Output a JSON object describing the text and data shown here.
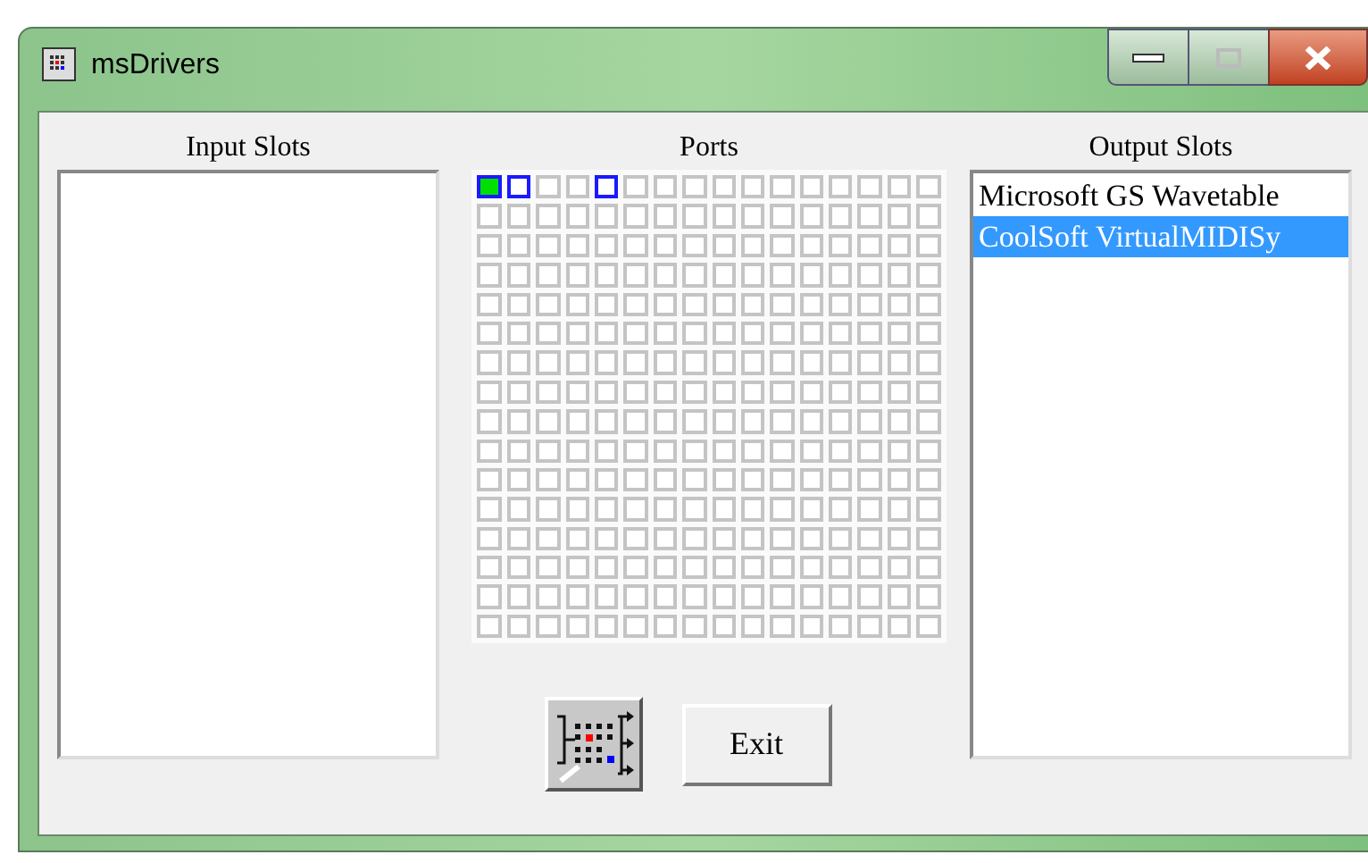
{
  "window": {
    "title": "msDrivers"
  },
  "input_slots": {
    "label": "Input Slots"
  },
  "ports": {
    "label": "Ports",
    "rows": [
      [
        {
          "kind": "on"
        },
        {
          "kind": "linked"
        },
        {
          "kind": "off"
        },
        {
          "kind": "off"
        },
        {
          "kind": "linked"
        },
        {
          "kind": "off"
        },
        {
          "kind": "off"
        },
        {
          "kind": "off"
        },
        {
          "kind": "off"
        },
        {
          "kind": "off"
        },
        {
          "kind": "off"
        },
        {
          "kind": "off"
        },
        {
          "kind": "off"
        },
        {
          "kind": "off"
        },
        {
          "kind": "off"
        },
        {
          "kind": "off"
        }
      ],
      [
        {
          "kind": "off"
        },
        {
          "kind": "off"
        },
        {
          "kind": "off"
        },
        {
          "kind": "off"
        },
        {
          "kind": "off"
        },
        {
          "kind": "off"
        },
        {
          "kind": "off"
        },
        {
          "kind": "off"
        },
        {
          "kind": "off"
        },
        {
          "kind": "off"
        },
        {
          "kind": "off"
        },
        {
          "kind": "off"
        },
        {
          "kind": "off"
        },
        {
          "kind": "off"
        },
        {
          "kind": "off"
        },
        {
          "kind": "off"
        }
      ],
      [
        {
          "kind": "off"
        },
        {
          "kind": "off"
        },
        {
          "kind": "off"
        },
        {
          "kind": "off"
        },
        {
          "kind": "off"
        },
        {
          "kind": "off"
        },
        {
          "kind": "off"
        },
        {
          "kind": "off"
        },
        {
          "kind": "off"
        },
        {
          "kind": "off"
        },
        {
          "kind": "off"
        },
        {
          "kind": "off"
        },
        {
          "kind": "off"
        },
        {
          "kind": "off"
        },
        {
          "kind": "off"
        },
        {
          "kind": "off"
        }
      ],
      [
        {
          "kind": "off"
        },
        {
          "kind": "off"
        },
        {
          "kind": "off"
        },
        {
          "kind": "off"
        },
        {
          "kind": "off"
        },
        {
          "kind": "off"
        },
        {
          "kind": "off"
        },
        {
          "kind": "off"
        },
        {
          "kind": "off"
        },
        {
          "kind": "off"
        },
        {
          "kind": "off"
        },
        {
          "kind": "off"
        },
        {
          "kind": "off"
        },
        {
          "kind": "off"
        },
        {
          "kind": "off"
        },
        {
          "kind": "off"
        }
      ],
      [
        {
          "kind": "off"
        },
        {
          "kind": "off"
        },
        {
          "kind": "off"
        },
        {
          "kind": "off"
        },
        {
          "kind": "off"
        },
        {
          "kind": "off"
        },
        {
          "kind": "off"
        },
        {
          "kind": "off"
        },
        {
          "kind": "off"
        },
        {
          "kind": "off"
        },
        {
          "kind": "off"
        },
        {
          "kind": "off"
        },
        {
          "kind": "off"
        },
        {
          "kind": "off"
        },
        {
          "kind": "off"
        },
        {
          "kind": "off"
        }
      ],
      [
        {
          "kind": "off"
        },
        {
          "kind": "off"
        },
        {
          "kind": "off"
        },
        {
          "kind": "off"
        },
        {
          "kind": "off"
        },
        {
          "kind": "off"
        },
        {
          "kind": "off"
        },
        {
          "kind": "off"
        },
        {
          "kind": "off"
        },
        {
          "kind": "off"
        },
        {
          "kind": "off"
        },
        {
          "kind": "off"
        },
        {
          "kind": "off"
        },
        {
          "kind": "off"
        },
        {
          "kind": "off"
        },
        {
          "kind": "off"
        }
      ],
      [
        {
          "kind": "off"
        },
        {
          "kind": "off"
        },
        {
          "kind": "off"
        },
        {
          "kind": "off"
        },
        {
          "kind": "off"
        },
        {
          "kind": "off"
        },
        {
          "kind": "off"
        },
        {
          "kind": "off"
        },
        {
          "kind": "off"
        },
        {
          "kind": "off"
        },
        {
          "kind": "off"
        },
        {
          "kind": "off"
        },
        {
          "kind": "off"
        },
        {
          "kind": "off"
        },
        {
          "kind": "off"
        },
        {
          "kind": "off"
        }
      ],
      [
        {
          "kind": "off"
        },
        {
          "kind": "off"
        },
        {
          "kind": "off"
        },
        {
          "kind": "off"
        },
        {
          "kind": "off"
        },
        {
          "kind": "off"
        },
        {
          "kind": "off"
        },
        {
          "kind": "off"
        },
        {
          "kind": "off"
        },
        {
          "kind": "off"
        },
        {
          "kind": "off"
        },
        {
          "kind": "off"
        },
        {
          "kind": "off"
        },
        {
          "kind": "off"
        },
        {
          "kind": "off"
        },
        {
          "kind": "off"
        }
      ],
      [
        {
          "kind": "off"
        },
        {
          "kind": "off"
        },
        {
          "kind": "off"
        },
        {
          "kind": "off"
        },
        {
          "kind": "off"
        },
        {
          "kind": "off"
        },
        {
          "kind": "off"
        },
        {
          "kind": "off"
        },
        {
          "kind": "off"
        },
        {
          "kind": "off"
        },
        {
          "kind": "off"
        },
        {
          "kind": "off"
        },
        {
          "kind": "off"
        },
        {
          "kind": "off"
        },
        {
          "kind": "off"
        },
        {
          "kind": "off"
        }
      ],
      [
        {
          "kind": "off"
        },
        {
          "kind": "off"
        },
        {
          "kind": "off"
        },
        {
          "kind": "off"
        },
        {
          "kind": "off"
        },
        {
          "kind": "off"
        },
        {
          "kind": "off"
        },
        {
          "kind": "off"
        },
        {
          "kind": "off"
        },
        {
          "kind": "off"
        },
        {
          "kind": "off"
        },
        {
          "kind": "off"
        },
        {
          "kind": "off"
        },
        {
          "kind": "off"
        },
        {
          "kind": "off"
        },
        {
          "kind": "off"
        }
      ],
      [
        {
          "kind": "off"
        },
        {
          "kind": "off"
        },
        {
          "kind": "off"
        },
        {
          "kind": "off"
        },
        {
          "kind": "off"
        },
        {
          "kind": "off"
        },
        {
          "kind": "off"
        },
        {
          "kind": "off"
        },
        {
          "kind": "off"
        },
        {
          "kind": "off"
        },
        {
          "kind": "off"
        },
        {
          "kind": "off"
        },
        {
          "kind": "off"
        },
        {
          "kind": "off"
        },
        {
          "kind": "off"
        },
        {
          "kind": "off"
        }
      ],
      [
        {
          "kind": "off"
        },
        {
          "kind": "off"
        },
        {
          "kind": "off"
        },
        {
          "kind": "off"
        },
        {
          "kind": "off"
        },
        {
          "kind": "off"
        },
        {
          "kind": "off"
        },
        {
          "kind": "off"
        },
        {
          "kind": "off"
        },
        {
          "kind": "off"
        },
        {
          "kind": "off"
        },
        {
          "kind": "off"
        },
        {
          "kind": "off"
        },
        {
          "kind": "off"
        },
        {
          "kind": "off"
        },
        {
          "kind": "off"
        }
      ],
      [
        {
          "kind": "off"
        },
        {
          "kind": "off"
        },
        {
          "kind": "off"
        },
        {
          "kind": "off"
        },
        {
          "kind": "off"
        },
        {
          "kind": "off"
        },
        {
          "kind": "off"
        },
        {
          "kind": "off"
        },
        {
          "kind": "off"
        },
        {
          "kind": "off"
        },
        {
          "kind": "off"
        },
        {
          "kind": "off"
        },
        {
          "kind": "off"
        },
        {
          "kind": "off"
        },
        {
          "kind": "off"
        },
        {
          "kind": "off"
        }
      ],
      [
        {
          "kind": "off"
        },
        {
          "kind": "off"
        },
        {
          "kind": "off"
        },
        {
          "kind": "off"
        },
        {
          "kind": "off"
        },
        {
          "kind": "off"
        },
        {
          "kind": "off"
        },
        {
          "kind": "off"
        },
        {
          "kind": "off"
        },
        {
          "kind": "off"
        },
        {
          "kind": "off"
        },
        {
          "kind": "off"
        },
        {
          "kind": "off"
        },
        {
          "kind": "off"
        },
        {
          "kind": "off"
        },
        {
          "kind": "off"
        }
      ],
      [
        {
          "kind": "off"
        },
        {
          "kind": "off"
        },
        {
          "kind": "off"
        },
        {
          "kind": "off"
        },
        {
          "kind": "off"
        },
        {
          "kind": "off"
        },
        {
          "kind": "off"
        },
        {
          "kind": "off"
        },
        {
          "kind": "off"
        },
        {
          "kind": "off"
        },
        {
          "kind": "off"
        },
        {
          "kind": "off"
        },
        {
          "kind": "off"
        },
        {
          "kind": "off"
        },
        {
          "kind": "off"
        },
        {
          "kind": "off"
        }
      ],
      [
        {
          "kind": "off"
        },
        {
          "kind": "off"
        },
        {
          "kind": "off"
        },
        {
          "kind": "off"
        },
        {
          "kind": "off"
        },
        {
          "kind": "off"
        },
        {
          "kind": "off"
        },
        {
          "kind": "off"
        },
        {
          "kind": "off"
        },
        {
          "kind": "off"
        },
        {
          "kind": "off"
        },
        {
          "kind": "off"
        },
        {
          "kind": "off"
        },
        {
          "kind": "off"
        },
        {
          "kind": "off"
        },
        {
          "kind": "off"
        }
      ]
    ]
  },
  "output_slots": {
    "label": "Output Slots",
    "items": [
      {
        "label": "Microsoft GS Wavetable",
        "selected": false
      },
      {
        "label": "CoolSoft VirtualMIDISy",
        "selected": true
      }
    ]
  },
  "buttons": {
    "exit": "Exit"
  }
}
